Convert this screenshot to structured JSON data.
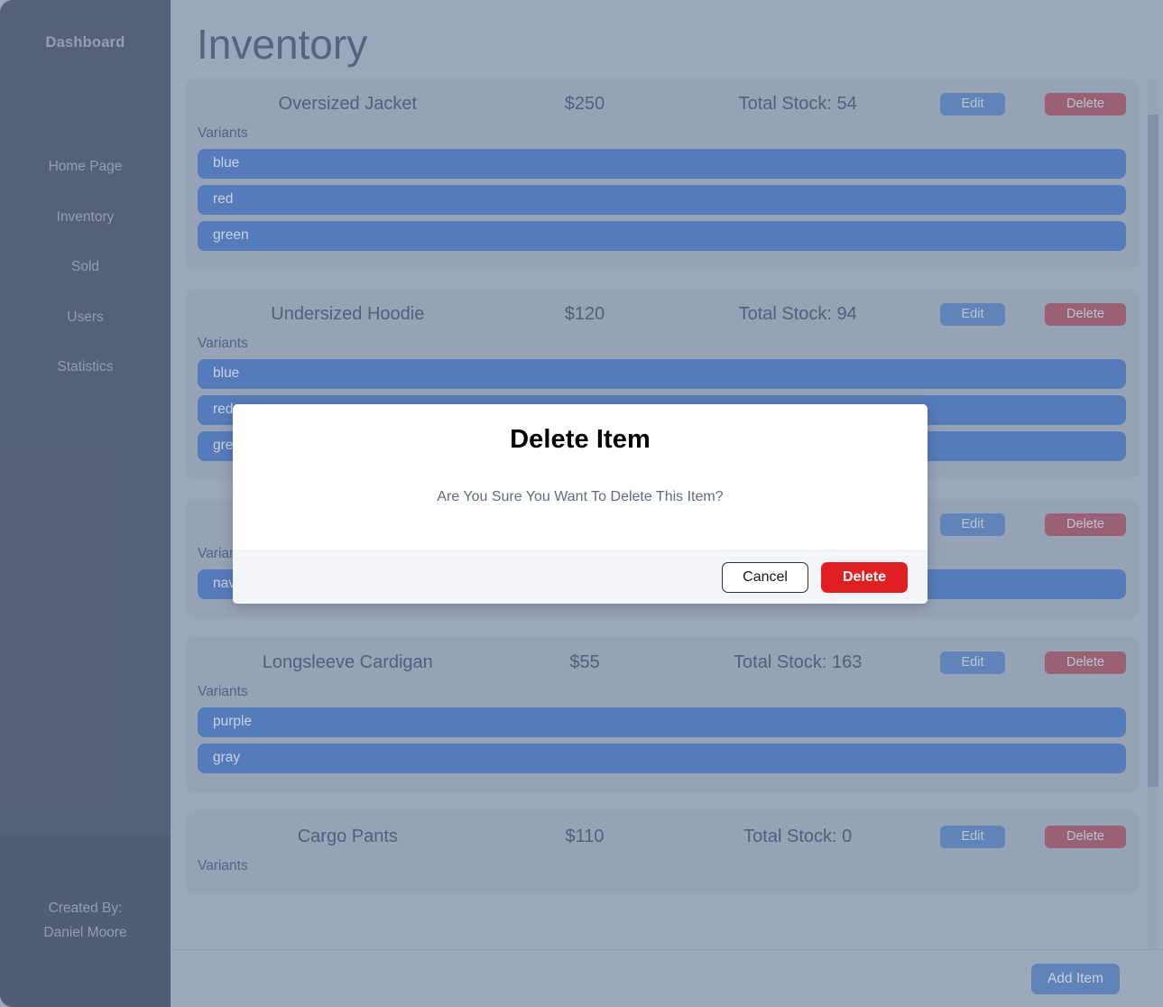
{
  "sidebar": {
    "brand": "Dashboard",
    "items": [
      {
        "label": "Home Page"
      },
      {
        "label": "Inventory"
      },
      {
        "label": "Sold"
      },
      {
        "label": "Users"
      },
      {
        "label": "Statistics"
      }
    ],
    "footer": {
      "created_by_label": "Created By:",
      "author": "Daniel Moore"
    }
  },
  "page": {
    "title": "Inventory"
  },
  "labels": {
    "variants": "Variants",
    "edit": "Edit",
    "delete": "Delete",
    "add_item": "Add Item"
  },
  "items": [
    {
      "name": "Oversized Jacket",
      "price": "$250",
      "stock": "Total Stock: 54",
      "variants": [
        "blue",
        "red",
        "green"
      ]
    },
    {
      "name": "Undersized Hoodie",
      "price": "$120",
      "stock": "Total Stock: 94",
      "variants": [
        "blue",
        "red",
        "green"
      ]
    },
    {
      "name": "",
      "price": "",
      "stock": "",
      "variants": [
        "navy"
      ]
    },
    {
      "name": "Longsleeve Cardigan",
      "price": "$55",
      "stock": "Total Stock: 163",
      "variants": [
        "purple",
        "gray"
      ]
    },
    {
      "name": "Cargo Pants",
      "price": "$110",
      "stock": "Total Stock: 0",
      "variants": []
    }
  ],
  "modal": {
    "title": "Delete Item",
    "message": "Are You Sure You Want To Delete This Item?",
    "cancel_label": "Cancel",
    "confirm_label": "Delete"
  },
  "colors": {
    "sidebar_bg": "#4c5870",
    "content_bg": "#a6b1c4",
    "card_bg": "#9fablf",
    "variant_blue": "#4d79c4",
    "edit_blue": "#5c84c2",
    "delete_rose": "#a3586a",
    "modal_delete_red": "#e01f20"
  }
}
